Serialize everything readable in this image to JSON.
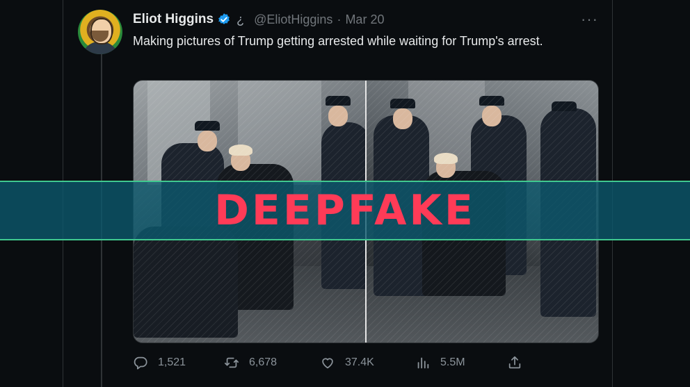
{
  "tweet": {
    "author_name": "Eliot Higgins",
    "flag_glyph": "¿",
    "handle": "@EliotHiggins",
    "separator": "·",
    "date": "Mar 20",
    "more_glyph": "···",
    "text": "Making pictures of Trump getting arrested while waiting for Trump's arrest."
  },
  "overlay": {
    "banner_text": "DEEPFAKE",
    "banner_color": "#ff3b57",
    "banner_border_color": "#40c98f"
  },
  "actions": {
    "replies": "1,521",
    "retweets": "6,678",
    "likes": "37.4K",
    "views": "5.5M",
    "icons": [
      "reply-icon",
      "retweet-icon",
      "like-icon",
      "views-icon",
      "share-icon"
    ]
  },
  "colors": {
    "background": "#0a0d10",
    "verified": "#1d9bf0",
    "muted": "#71767b"
  }
}
